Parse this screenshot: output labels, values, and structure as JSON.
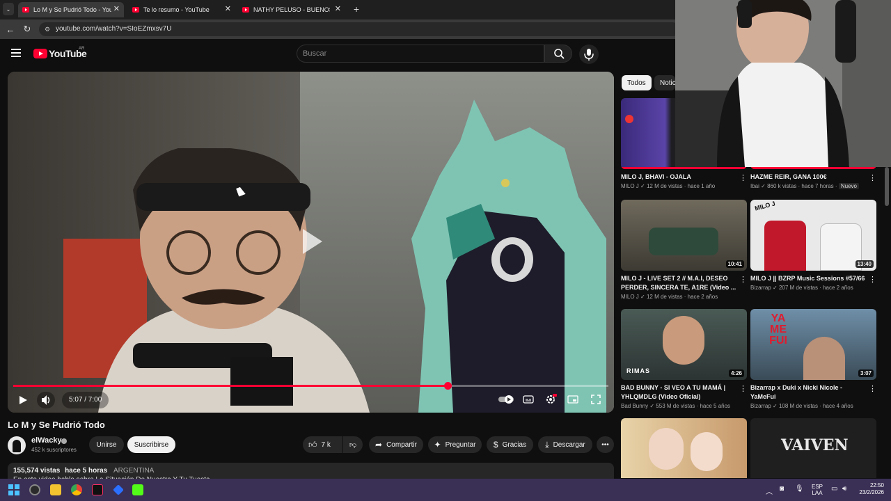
{
  "browser": {
    "tabs": [
      {
        "label": "Lo M y Se Pudrió Todo - YouTube",
        "active": true
      },
      {
        "label": "Te lo resumo - YouTube",
        "active": false
      },
      {
        "label": "NATHY PELUSO - BUENOS AIRES",
        "active": false
      }
    ],
    "url": "youtube.com/watch?v=SIoEZmxsv7U"
  },
  "youtube": {
    "logo_text": "YouTube",
    "region": "AR",
    "search_placeholder": "Buscar"
  },
  "player": {
    "current_time": "5:07",
    "duration": "7:00",
    "time_display": "5:07 / 7:00",
    "progress_fraction": 0.73
  },
  "video": {
    "title": "Lo M y Se Pudrió Todo",
    "channel": "elWacky",
    "subscribers": "452 k suscriptores",
    "join_label": "Unirse",
    "subscribe_label": "Suscribirse",
    "likes": "7 k",
    "share_label": "Compartir",
    "ask_label": "Preguntar",
    "thanks_label": "Gracias",
    "download_label": "Descargar",
    "views": "155,574 vistas",
    "posted": "hace 5 horas",
    "country": "ARGENTINA",
    "desc_line": "En este video hablo sobre La Situación De Nuestra Y Tu Tuesta"
  },
  "chips": [
    "Todos",
    "Notic"
  ],
  "recommendations": [
    {
      "title": "MILO J, BHAVI - OJALA",
      "channel": "MILO J",
      "meta": "12 M de vistas · hace 1 año",
      "duration": "",
      "badge": ""
    },
    {
      "title": "HAZME REIR, GANA 100€",
      "channel": "Ibai",
      "meta": "860 k vistas · hace 7 horas ·",
      "duration": "",
      "badge": "Nuevo"
    },
    {
      "title": "MILO J - LIVE SET 2 // M.A.I, DESEO PERDER, SINCERA TE, A1RE (Video ...",
      "channel": "MILO J",
      "meta": "12 M de vistas · hace 2 años",
      "duration": "10:41",
      "badge": ""
    },
    {
      "title": "MILO J || BZRP Music Sessions #57/66",
      "channel": "Bizarrap",
      "meta": "207 M de vistas · hace 2 años",
      "duration": "13:40",
      "badge": ""
    },
    {
      "title": "BAD BUNNY - SI VEO A TU MAMÁ | YHLQMDLG (Video Oficial)",
      "channel": "Bad Bunny",
      "meta": "553 M de vistas · hace 5 años",
      "duration": "4:26",
      "badge": ""
    },
    {
      "title": "Bizarrap x Duki x Nicki Nicole - YaMeFui",
      "channel": "Bizarrap",
      "meta": "108 M de vistas · hace 4 años",
      "duration": "3:07",
      "badge": ""
    }
  ],
  "thumb_text": {
    "rimas": "RIMAS",
    "yamefui": "YA ME FUI",
    "vaiven": "VAIVEN",
    "milo": "MILO J"
  },
  "tray": {
    "lang_line1": "ESP",
    "lang_line2": "LAA",
    "time": "22:50",
    "date": "23/2/2026"
  }
}
